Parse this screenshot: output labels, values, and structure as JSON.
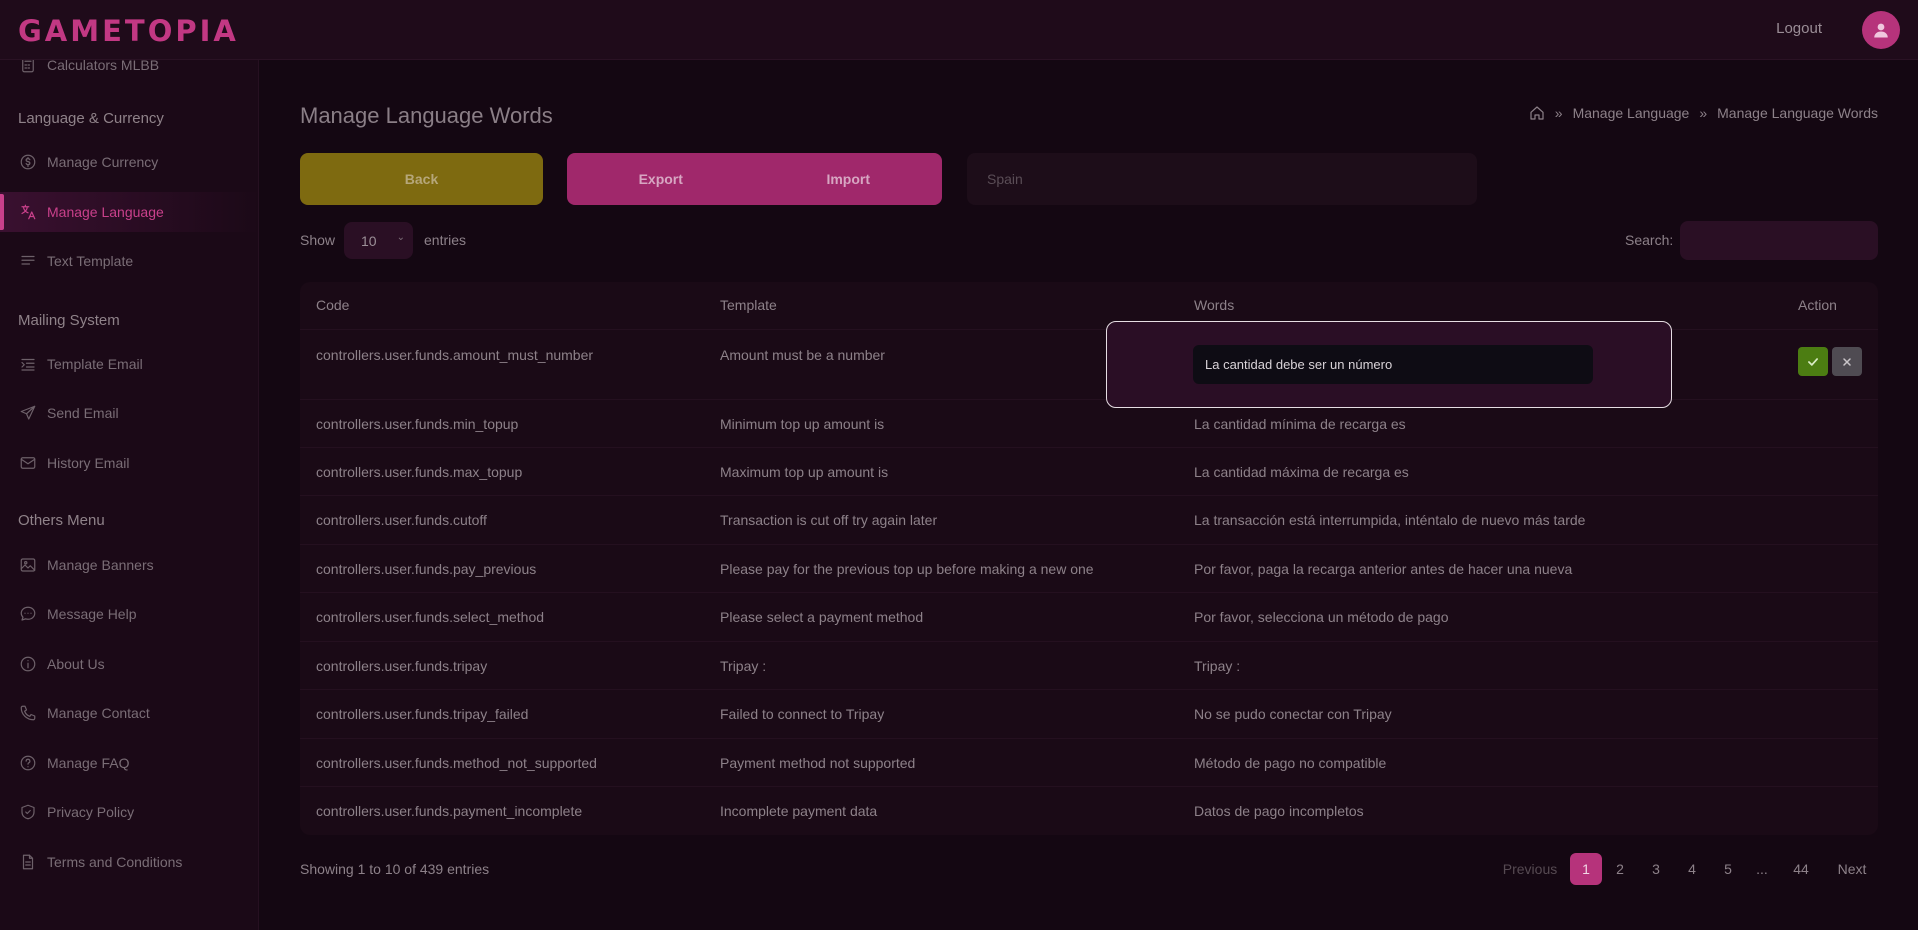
{
  "app": {
    "logo": "GAMETOPIA",
    "logout": "Logout"
  },
  "sidebar": {
    "partial_item": "Calculators MLBB",
    "sections": [
      {
        "title": "Language & Currency",
        "items": [
          "Manage Currency",
          "Manage Language",
          "Text Template"
        ]
      },
      {
        "title": "Mailing System",
        "items": [
          "Template Email",
          "Send Email",
          "History Email"
        ]
      },
      {
        "title": "Others Menu",
        "items": [
          "Manage Banners",
          "Message Help",
          "About Us",
          "Manage Contact",
          "Manage FAQ",
          "Privacy Policy",
          "Terms and Conditions"
        ]
      }
    ],
    "active": "Manage Language"
  },
  "page": {
    "title": "Manage Language Words",
    "breadcrumb": [
      "Manage Language",
      "Manage Language Words"
    ]
  },
  "toolbar": {
    "back": "Back",
    "export": "Export",
    "import": "Import",
    "language": "Spain"
  },
  "table_controls": {
    "show": "Show",
    "entries_value": "10",
    "entries": "entries",
    "search": "Search:"
  },
  "table": {
    "headers": [
      "Code",
      "Template",
      "Words",
      "Action"
    ],
    "editing_value": "La cantidad debe ser un número",
    "rows": [
      {
        "code": "controllers.user.funds.amount_must_number",
        "template": "Amount must be a number",
        "words": ""
      },
      {
        "code": "controllers.user.funds.min_topup",
        "template": "Minimum top up amount is",
        "words": "La cantidad mínima de recarga es"
      },
      {
        "code": "controllers.user.funds.max_topup",
        "template": "Maximum top up amount is",
        "words": "La cantidad máxima de recarga es"
      },
      {
        "code": "controllers.user.funds.cutoff",
        "template": "Transaction is cut off try again later",
        "words": "La transacción está interrumpida, inténtalo de nuevo más tarde"
      },
      {
        "code": "controllers.user.funds.pay_previous",
        "template": "Please pay for the previous top up before making a new one",
        "words": "Por favor, paga la recarga anterior antes de hacer una nueva"
      },
      {
        "code": "controllers.user.funds.select_method",
        "template": "Please select a payment method",
        "words": "Por favor, selecciona un método de pago"
      },
      {
        "code": "controllers.user.funds.tripay",
        "template": "Tripay :",
        "words": "Tripay :"
      },
      {
        "code": "controllers.user.funds.tripay_failed",
        "template": "Failed to connect to Tripay",
        "words": "No se pudo conectar con Tripay"
      },
      {
        "code": "controllers.user.funds.method_not_supported",
        "template": "Payment method not supported",
        "words": "Método de pago no compatible"
      },
      {
        "code": "controllers.user.funds.payment_incomplete",
        "template": "Incomplete payment data",
        "words": "Datos de pago incompletos"
      }
    ]
  },
  "footer": {
    "info": "Showing 1 to 10 of 439 entries",
    "pagination": [
      "Previous",
      "1",
      "2",
      "3",
      "4",
      "5",
      "...",
      "44",
      "Next"
    ],
    "current_page": "1"
  },
  "colors": {
    "accent": "#b6337b",
    "back_button": "#7e6a10",
    "ok": "#4c7d12"
  }
}
